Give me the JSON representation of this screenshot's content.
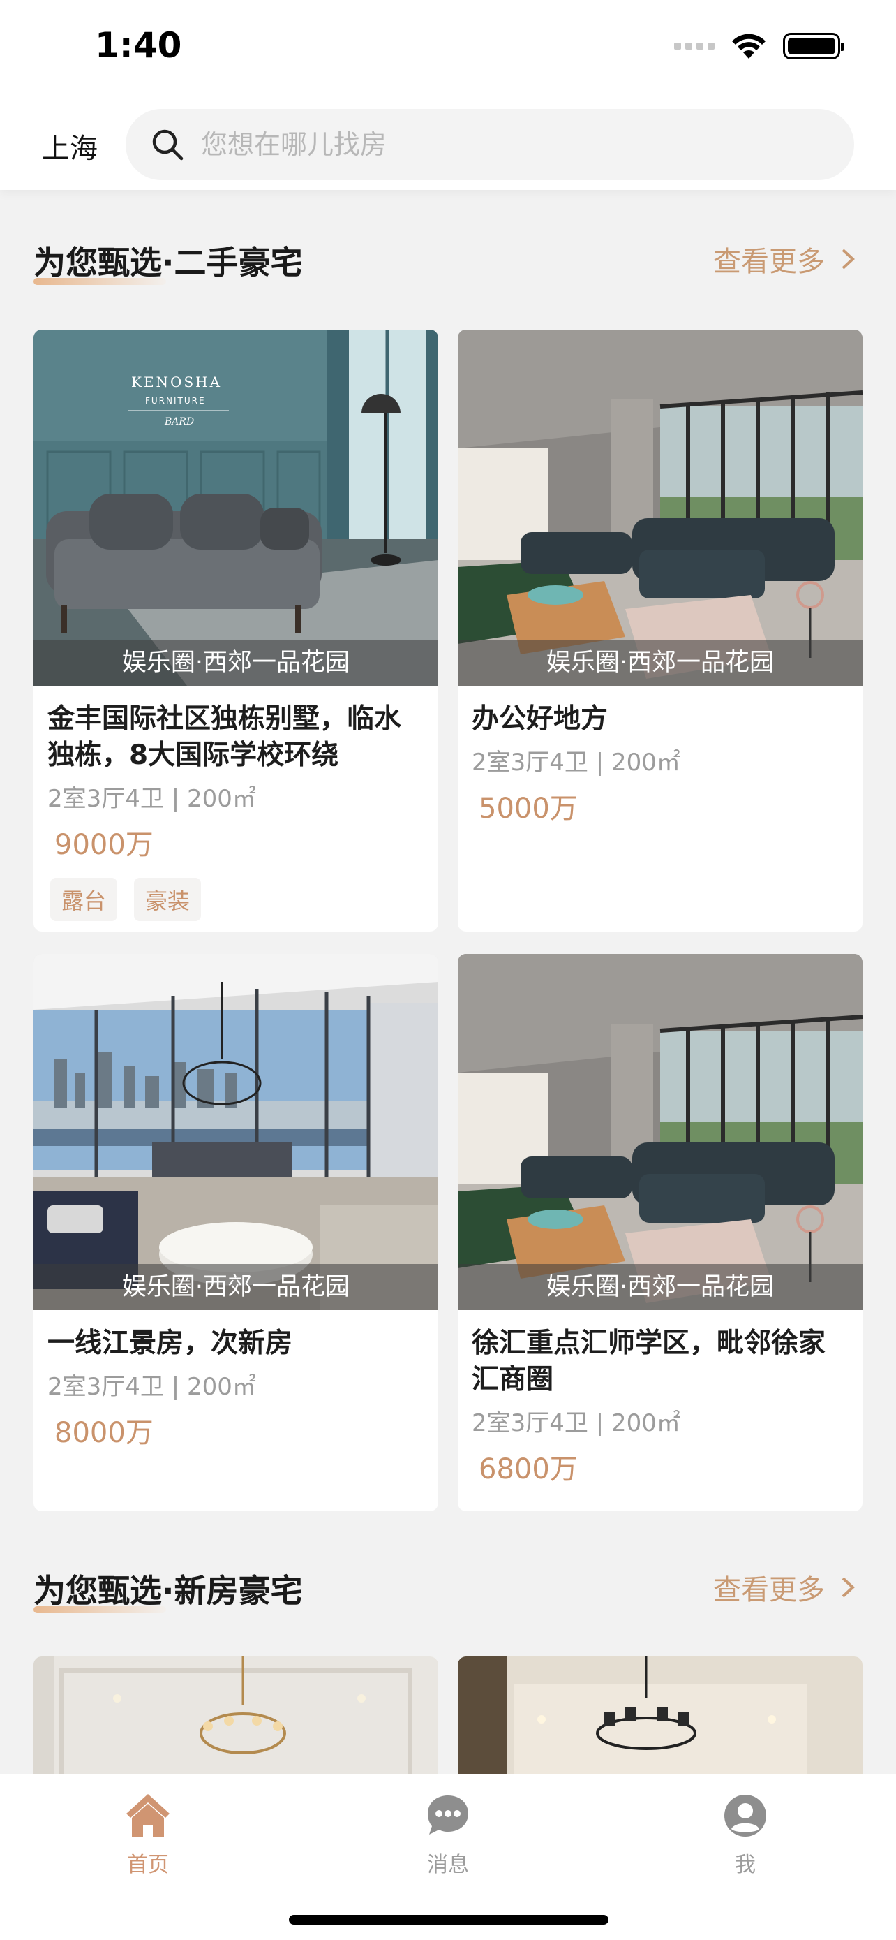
{
  "status_bar": {
    "time": "1:40"
  },
  "header": {
    "city": "上海",
    "search_placeholder": "您想在哪儿找房"
  },
  "sections": [
    {
      "title": "为您甄选·二手豪宅",
      "more": "查看更多"
    },
    {
      "title": "为您甄选·新房豪宅",
      "more": "查看更多"
    }
  ],
  "listings": [
    {
      "caption": "娱乐圈·西郊一品花园",
      "title": "金丰国际社区独栋别墅，临水独栋，8大国际学校环绕",
      "meta": "2室3厅4卫 | 200㎡",
      "price": "9000万",
      "tags": [
        "露台",
        "豪装"
      ]
    },
    {
      "caption": "娱乐圈·西郊一品花园",
      "title": "办公好地方",
      "meta": "2室3厅4卫 | 200㎡",
      "price": "5000万",
      "tags": []
    },
    {
      "caption": "娱乐圈·西郊一品花园",
      "title": "一线江景房，次新房",
      "meta": "2室3厅4卫 | 200㎡",
      "price": "8000万",
      "tags": []
    },
    {
      "caption": "娱乐圈·西郊一品花园",
      "title": "徐汇重点汇师学区，毗邻徐家汇商圈",
      "meta": "2室3厅4卫 | 200㎡",
      "price": "6800万",
      "tags": []
    }
  ],
  "photo_text": {
    "brand": "KENOSHA",
    "sub": "FURNITURE",
    "name": "BARD"
  },
  "tabbar": [
    {
      "label": "首页",
      "icon": "home-icon",
      "active": true
    },
    {
      "label": "消息",
      "icon": "chat-icon",
      "active": false
    },
    {
      "label": "我",
      "icon": "user-icon",
      "active": false
    }
  ],
  "colors": {
    "accent": "#d09572",
    "price": "#c9926b",
    "background": "#f2f2f2"
  }
}
